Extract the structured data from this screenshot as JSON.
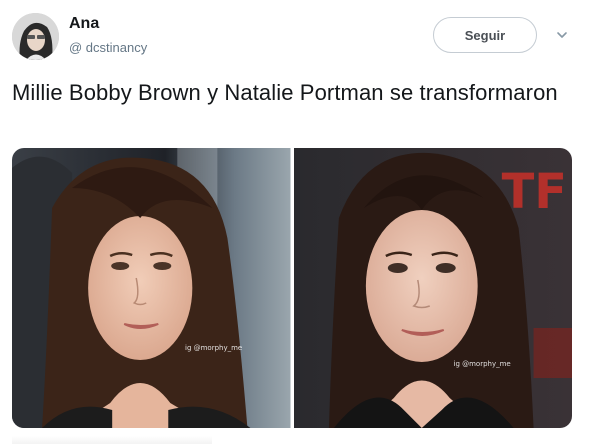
{
  "tweet": {
    "author": {
      "name": "Ana",
      "handle": "@ dcstinancy"
    },
    "follow_label": "Seguir",
    "text": "Millie Bobby Brown y Natalie Portman se transformaron",
    "images": [
      {
        "watermark": "ig @morphy_me"
      },
      {
        "watermark": "ig @morphy_me"
      }
    ]
  },
  "icons": {
    "menu": "chevron-down-icon",
    "avatar": "profile-photo"
  },
  "colors": {
    "text": "#14171a",
    "secondary": "#657786",
    "button_border": "#c5ccd3"
  }
}
